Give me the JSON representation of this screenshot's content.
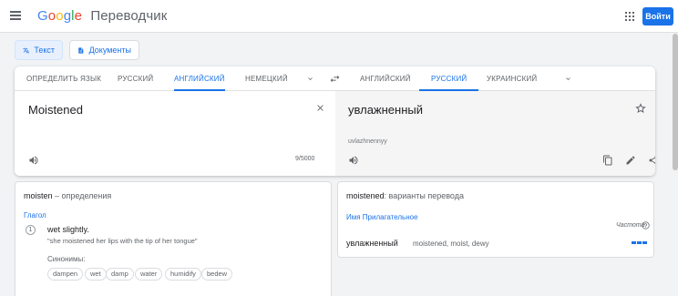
{
  "header": {
    "logo_letters": [
      "G",
      "o",
      "o",
      "g",
      "l",
      "e"
    ],
    "product": "Переводчик",
    "signin_label": "Войти",
    "menu_icon": "hamburger-menu-icon",
    "apps_icon": "apps-grid-icon"
  },
  "modes": [
    {
      "label": "Текст",
      "icon": "translate-icon",
      "active": true
    },
    {
      "label": "Документы",
      "icon": "document-icon",
      "active": false
    }
  ],
  "source_langs": [
    {
      "label": "ОПРЕДЕЛИТЬ ЯЗЫК",
      "active": false
    },
    {
      "label": "РУССКИЙ",
      "active": false
    },
    {
      "label": "АНГЛИЙСКИЙ",
      "active": true
    },
    {
      "label": "НЕМЕЦКИЙ",
      "active": false
    }
  ],
  "target_langs": [
    {
      "label": "АНГЛИЙСКИЙ",
      "active": false
    },
    {
      "label": "РУССКИЙ",
      "active": true
    },
    {
      "label": "УКРАИНСКИЙ",
      "active": false
    }
  ],
  "source": {
    "text": "Moistened",
    "char_count": "9/5000"
  },
  "target": {
    "text": "увлажненный",
    "transliteration": "uvlazhnennyy"
  },
  "definitions": {
    "word": "moisten",
    "heading_suffix": " – определения",
    "part_of_speech": "Глагол",
    "items": [
      {
        "number": "1",
        "text": "wet slightly.",
        "example": "\"she moistened her lips with the tip of her tongue\""
      }
    ],
    "synonyms_label": "Синонимы:",
    "synonyms": [
      "dampen",
      "wet",
      "damp",
      "water",
      "humidify",
      "bedew"
    ]
  },
  "translations": {
    "word": "moistened",
    "heading_suffix": ": варианты перевода",
    "part_of_speech": "Имя Прилагательное",
    "frequency_label": "Частота",
    "rows": [
      {
        "word": "увлажненный",
        "back_translations": "moistened, moist, dewy",
        "frequency": 3
      }
    ]
  },
  "colors": {
    "accent": "#1a73e8",
    "text": "#202124",
    "muted": "#5f6368"
  }
}
